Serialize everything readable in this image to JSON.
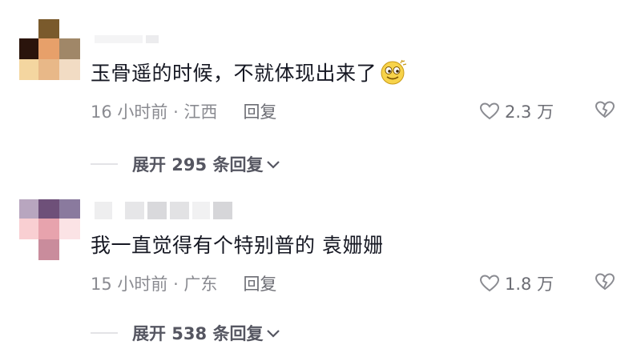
{
  "comments": [
    {
      "text": "玉骨遥的时候，不就体现出来了",
      "emoji": "sly-face-emoji",
      "time_location": "16 小时前 · 江西",
      "reply_label": "回复",
      "likes": "2.3 万",
      "expand_label": "展开 295 条回复"
    },
    {
      "text": "我一直觉得有个特别普的 袁姗姗",
      "time_location": "15 小时前 · 广东",
      "reply_label": "回复",
      "likes": "1.8 万",
      "expand_label": "展开 538 条回复"
    }
  ],
  "icons": {
    "like": "heart-outline-icon",
    "dislike": "broken-heart-icon",
    "expand": "chevron-down-icon"
  }
}
